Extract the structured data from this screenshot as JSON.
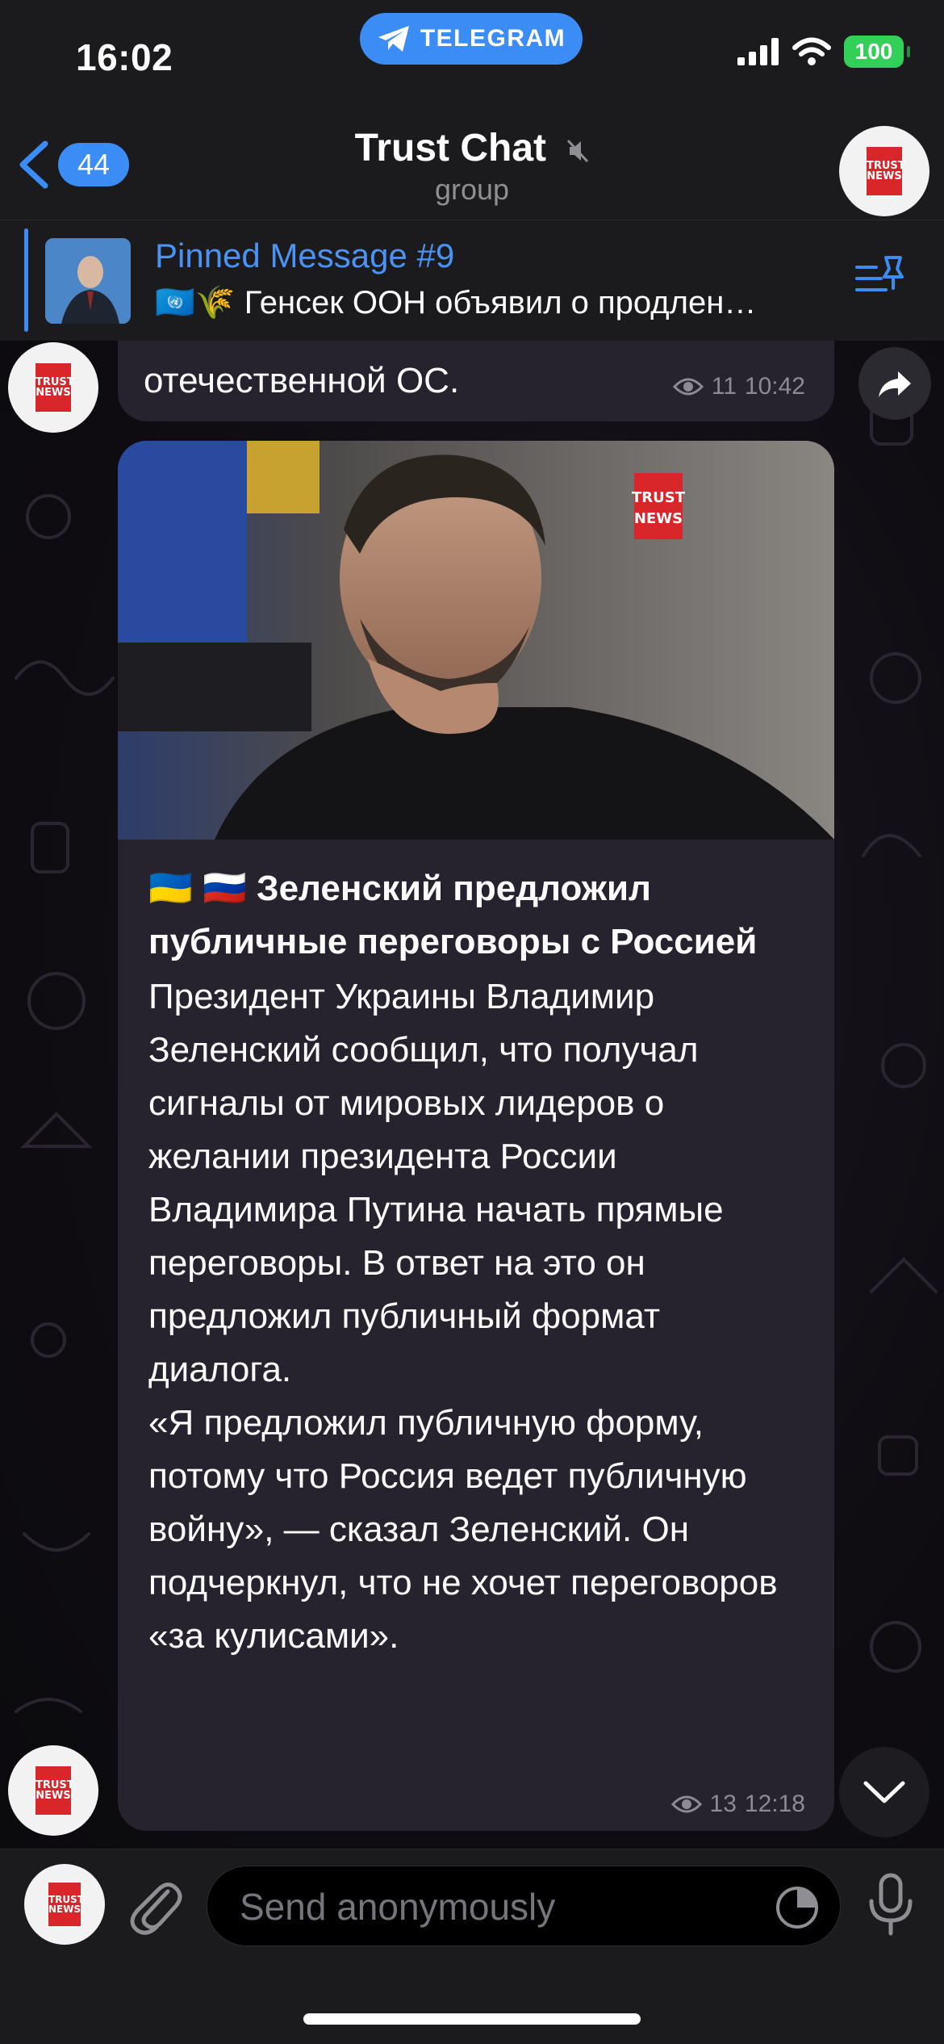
{
  "status_bar": {
    "time": "16:02",
    "app_pill": "TELEGRAM",
    "battery": "100"
  },
  "header": {
    "back_count": "44",
    "title": "Trust Chat",
    "subtitle": "group",
    "avatar_logo": [
      "TRUST",
      "NEWS"
    ]
  },
  "pinned": {
    "title": "Pinned Message #9",
    "text": "🇺🇳🌾 Генсек ООН объявил о продлен…"
  },
  "prev_message": {
    "text_partial": "отечественной ОС.",
    "views": "11",
    "time": "10:42"
  },
  "post": {
    "watermark": [
      "TRUST",
      "NEWS"
    ],
    "title": "🇺🇦 🇷🇺 Зеленский предложил публичные переговоры с Россией",
    "body": "Президент Украины Владимир Зеленский сообщил, что получал сигналы от мировых лидеров о желании президента России Владимира Путина начать прямые переговоры. В ответ на это он предложил публичный формат диалога.\n«Я предложил публичную форму, потому что Россия ведет публичную войну», — сказал Зеленский. Он подчеркнул, что не хочет переговоров «за кулисами».",
    "views": "13",
    "time": "12:18"
  },
  "composer": {
    "placeholder": "Send anonymously"
  },
  "colors": {
    "accent": "#3b8df5",
    "bubble": "#26222e",
    "battery": "#32d058",
    "logo_red": "#d8262a"
  },
  "icons": [
    "chevron-left-icon",
    "mute-icon",
    "pin-list-icon",
    "share-icon",
    "eye-icon",
    "chevron-down-icon",
    "paperclip-icon",
    "timer-icon",
    "microphone-icon",
    "telegram-plane-icon",
    "signal-icon",
    "wifi-icon"
  ]
}
